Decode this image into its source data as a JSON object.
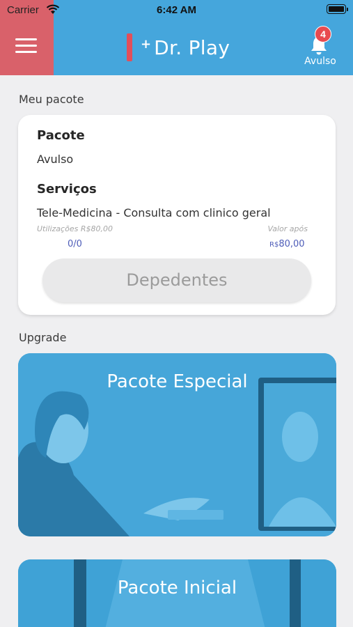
{
  "status_bar": {
    "carrier": "Carrier",
    "time": "6:42 AM"
  },
  "header": {
    "logo_text": "Dr. Play",
    "logo_mark": "+",
    "notification": {
      "count": "4",
      "label": "Avulso"
    },
    "colors": {
      "bar": "#45a6dc",
      "menu_block": "#d9616a",
      "badge": "#e84a4f"
    }
  },
  "my_package": {
    "section_title": "Meu pacote",
    "package_heading": "Pacote",
    "package_value": "Avulso",
    "services_heading": "Serviços",
    "service_name": "Tele-Medicina - Consulta com clinico geral",
    "usage_label": "Utilizações R$80,00",
    "usage_value": "0/0",
    "after_label": "Valor após",
    "after_currency": "R$",
    "after_value": "80,00",
    "dependents_button": "Depedentes"
  },
  "upgrade": {
    "section_title": "Upgrade",
    "packages": [
      {
        "title": "Pacote Especial"
      },
      {
        "title": "Pacote Inicial"
      }
    ]
  }
}
